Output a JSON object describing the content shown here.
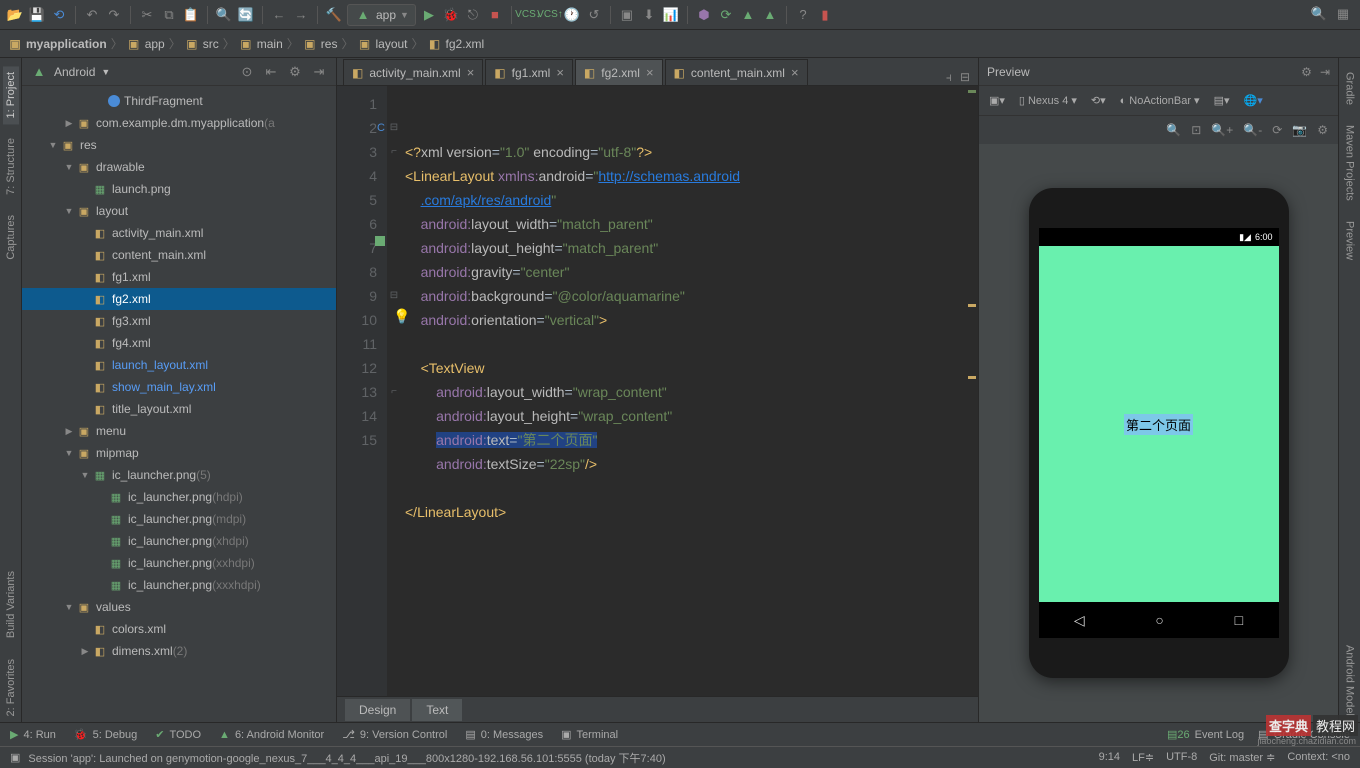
{
  "toolbar": {
    "app_label": "app"
  },
  "breadcrumb": [
    {
      "label": "myapplication",
      "bold": true,
      "icon": "folder"
    },
    {
      "label": "app",
      "bold": false,
      "icon": "module"
    },
    {
      "label": "src",
      "bold": false,
      "icon": "folder"
    },
    {
      "label": "main",
      "bold": false,
      "icon": "folder"
    },
    {
      "label": "res",
      "bold": false,
      "icon": "folder"
    },
    {
      "label": "layout",
      "bold": false,
      "icon": "folder"
    },
    {
      "label": "fg2.xml",
      "bold": false,
      "icon": "xml"
    }
  ],
  "left_tabs": [
    {
      "label": "1: Project",
      "active": true
    },
    {
      "label": "7: Structure",
      "active": false
    },
    {
      "label": "Captures",
      "active": false
    },
    {
      "label": "Build Variants",
      "active": false
    },
    {
      "label": "2: Favorites",
      "active": false
    }
  ],
  "right_tabs": [
    {
      "label": "Gradle",
      "active": false
    },
    {
      "label": "Maven Projects",
      "active": false
    },
    {
      "label": "Preview",
      "active": false
    },
    {
      "label": "Android Model",
      "active": false
    }
  ],
  "project": {
    "view_mode": "Android",
    "tree": [
      {
        "depth": 4,
        "arrow": "",
        "icon": "cls",
        "label": "ThirdFragment",
        "dim": "",
        "sel": false
      },
      {
        "depth": 2,
        "arrow": "▶",
        "icon": "pkg",
        "label": "com.example.dm.myapplication",
        "dim": " (a",
        "sel": false
      },
      {
        "depth": 1,
        "arrow": "▼",
        "icon": "folder",
        "label": "res",
        "dim": "",
        "sel": false
      },
      {
        "depth": 2,
        "arrow": "▼",
        "icon": "folder",
        "label": "drawable",
        "dim": "",
        "sel": false
      },
      {
        "depth": 3,
        "arrow": "",
        "icon": "img",
        "label": "launch.png",
        "dim": "",
        "sel": false
      },
      {
        "depth": 2,
        "arrow": "▼",
        "icon": "folder",
        "label": "layout",
        "dim": "",
        "sel": false
      },
      {
        "depth": 3,
        "arrow": "",
        "icon": "xml",
        "label": "activity_main.xml",
        "dim": "",
        "sel": false
      },
      {
        "depth": 3,
        "arrow": "",
        "icon": "xml",
        "label": "content_main.xml",
        "dim": "",
        "sel": false
      },
      {
        "depth": 3,
        "arrow": "",
        "icon": "xml",
        "label": "fg1.xml",
        "dim": "",
        "sel": false
      },
      {
        "depth": 3,
        "arrow": "",
        "icon": "xml",
        "label": "fg2.xml",
        "dim": "",
        "sel": true
      },
      {
        "depth": 3,
        "arrow": "",
        "icon": "xml",
        "label": "fg3.xml",
        "dim": "",
        "sel": false
      },
      {
        "depth": 3,
        "arrow": "",
        "icon": "xml",
        "label": "fg4.xml",
        "dim": "",
        "sel": false
      },
      {
        "depth": 3,
        "arrow": "",
        "icon": "xml",
        "label": "launch_layout.xml",
        "dim": "",
        "sel": false,
        "link": true
      },
      {
        "depth": 3,
        "arrow": "",
        "icon": "xml",
        "label": "show_main_lay.xml",
        "dim": "",
        "sel": false,
        "link": true
      },
      {
        "depth": 3,
        "arrow": "",
        "icon": "xml",
        "label": "title_layout.xml",
        "dim": "",
        "sel": false
      },
      {
        "depth": 2,
        "arrow": "▶",
        "icon": "folder",
        "label": "menu",
        "dim": "",
        "sel": false
      },
      {
        "depth": 2,
        "arrow": "▼",
        "icon": "folder",
        "label": "mipmap",
        "dim": "",
        "sel": false
      },
      {
        "depth": 3,
        "arrow": "▼",
        "icon": "img",
        "label": "ic_launcher.png",
        "dim": " (5)",
        "sel": false
      },
      {
        "depth": 4,
        "arrow": "",
        "icon": "img",
        "label": "ic_launcher.png",
        "dim": " (hdpi)",
        "sel": false
      },
      {
        "depth": 4,
        "arrow": "",
        "icon": "img",
        "label": "ic_launcher.png",
        "dim": " (mdpi)",
        "sel": false
      },
      {
        "depth": 4,
        "arrow": "",
        "icon": "img",
        "label": "ic_launcher.png",
        "dim": " (xhdpi)",
        "sel": false
      },
      {
        "depth": 4,
        "arrow": "",
        "icon": "img",
        "label": "ic_launcher.png",
        "dim": " (xxhdpi)",
        "sel": false
      },
      {
        "depth": 4,
        "arrow": "",
        "icon": "img",
        "label": "ic_launcher.png",
        "dim": " (xxxhdpi)",
        "sel": false
      },
      {
        "depth": 2,
        "arrow": "▼",
        "icon": "folder",
        "label": "values",
        "dim": "",
        "sel": false
      },
      {
        "depth": 3,
        "arrow": "",
        "icon": "xml",
        "label": "colors.xml",
        "dim": "",
        "sel": false
      },
      {
        "depth": 3,
        "arrow": "▶",
        "icon": "xml",
        "label": "dimens.xml",
        "dim": " (2)",
        "sel": false
      }
    ]
  },
  "editor": {
    "tabs": [
      {
        "label": "activity_main.xml",
        "active": false
      },
      {
        "label": "fg1.xml",
        "active": false
      },
      {
        "label": "fg2.xml",
        "active": true
      },
      {
        "label": "content_main.xml",
        "active": false
      }
    ],
    "bottom_tabs": {
      "design": "Design",
      "text": "Text"
    },
    "line_count": 15
  },
  "preview": {
    "title": "Preview",
    "device": "Nexus 4",
    "theme": "NoActionBar",
    "status_time": "6:00",
    "screen_text": "第二个页面"
  },
  "bottom": {
    "run": "4: Run",
    "debug": "5: Debug",
    "todo": "TODO",
    "monitor": "6: Android Monitor",
    "vc": "9: Version Control",
    "messages": "0: Messages",
    "terminal": "Terminal",
    "eventlog": "Event Log",
    "gradle": "Gradle Console"
  },
  "status": {
    "msg": "Session 'app': Launched on genymotion-google_nexus_7___4_4_4___api_19___800x1280-192.168.56.101:5555 (today 下午7:40)",
    "pos": "9:14",
    "le": "LF≑",
    "enc": "UTF-8",
    "git": "Git: master ≑",
    "ctx": "Context: <no"
  },
  "watermark": {
    "brand": "查字典",
    "sub": "教程网",
    "url": "jiaocheng.chazidian.com"
  }
}
